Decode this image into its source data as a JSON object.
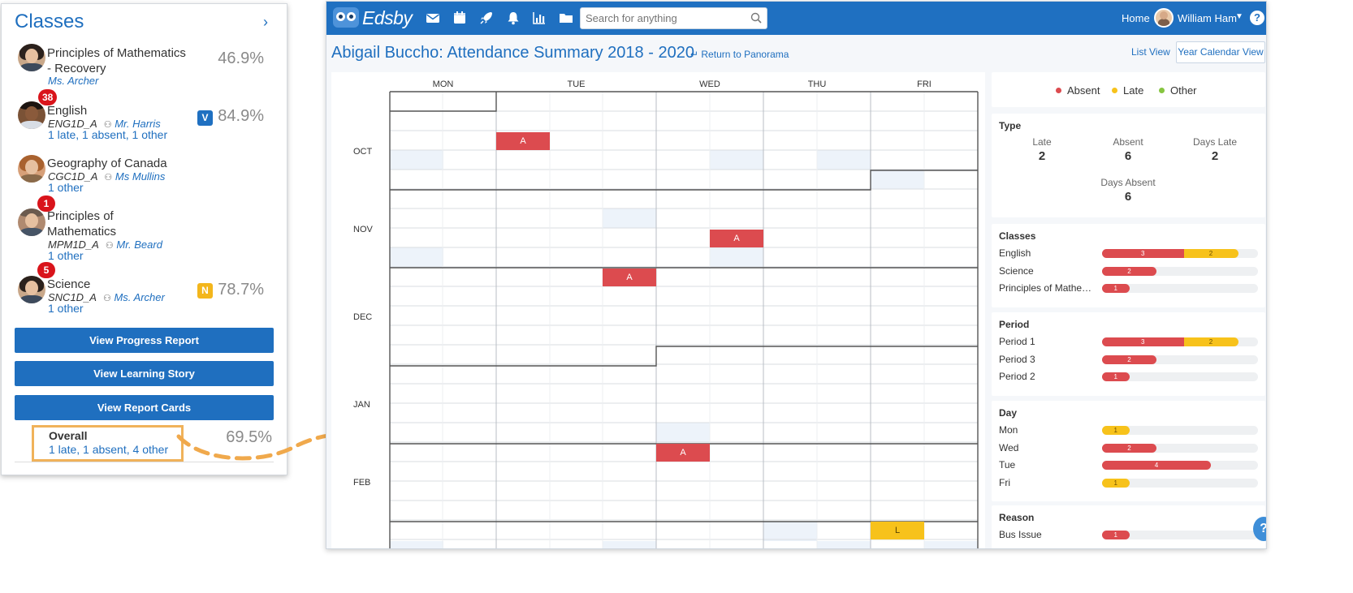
{
  "classes_card": {
    "title": "Classes",
    "chevron": "›",
    "classes": [
      {
        "name": "Principles of Mathematics - Recovery",
        "teacher": "Ms. Archer",
        "percent": "46.9%"
      },
      {
        "name": "English",
        "badge_count": "38",
        "code": "ENG1D_A",
        "teacher": "Mr. Harris",
        "summary": "1 late, 1 absent, 1 other",
        "grade_letter": "V",
        "percent": "84.9%",
        "grade_color": "#1f70c1"
      },
      {
        "name": "Geography of Canada",
        "code": "CGC1D_A",
        "teacher": "Ms Mullins",
        "summary": "1 other"
      },
      {
        "name": "Principles of Mathematics",
        "badge_count": "1",
        "code": "MPM1D_A",
        "teacher": "Mr. Beard",
        "summary": "1 other"
      },
      {
        "name": "Science",
        "badge_count": "5",
        "code": "SNC1D_A",
        "teacher": "Ms. Archer",
        "summary": "1 other",
        "grade_letter": "N",
        "percent": "78.7%",
        "grade_color": "#f3b61c"
      }
    ],
    "buttons": {
      "progress": "View Progress Report",
      "learning": "View Learning Story",
      "report_cards": "View Report Cards"
    },
    "overall": {
      "label": "Overall",
      "summary": "1 late, 1 absent, 4 other",
      "percent": "69.5%"
    }
  },
  "topbar": {
    "logo": "Edsby",
    "nav_icons": [
      "mail-icon",
      "calendar-icon",
      "rocket-icon",
      "bell-icon",
      "bar-chart-icon",
      "folder-icon"
    ],
    "search_placeholder": "Search for anything",
    "home": "Home",
    "user_name": "William Ham",
    "help": "?"
  },
  "page": {
    "title": "Abigail Buccho: Attendance Summary 2018 - 2020",
    "return_link": "↵ Return to Panorama",
    "list_view": "List View",
    "year_view": "Year Calendar View"
  },
  "calendar": {
    "days": [
      "MON",
      "TUE",
      "WED",
      "THU",
      "FRI"
    ],
    "months": [
      "OCT",
      "NOV",
      "DEC",
      "JAN",
      "FEB"
    ],
    "marks": [
      {
        "label": "A",
        "color": "#dc4b4f"
      },
      {
        "label": "A",
        "color": "#dc4b4f"
      },
      {
        "label": "A",
        "color": "#dc4b4f"
      },
      {
        "label": "A",
        "color": "#dc4b4f"
      },
      {
        "label": "L",
        "color": "#f7c21b"
      }
    ]
  },
  "legend": [
    {
      "label": "Absent",
      "color": "#dc4b4f"
    },
    {
      "label": "Late",
      "color": "#f7c21b"
    },
    {
      "label": "Other",
      "color": "#86c540"
    }
  ],
  "type_card": {
    "title": "Type",
    "late_label": "Late",
    "late": "2",
    "absent_label": "Absent",
    "absent": "6",
    "days_late_label": "Days Late",
    "days_late": "2",
    "days_absent_label": "Days Absent",
    "days_absent": "6"
  },
  "breakdowns": [
    {
      "title": "Classes",
      "rows": [
        {
          "label": "English",
          "absent": 3,
          "late": 2
        },
        {
          "label": "Science",
          "absent": 2,
          "late": 0
        },
        {
          "label": "Principles of Mathem...",
          "absent": 1,
          "late": 0
        }
      ]
    },
    {
      "title": "Period",
      "rows": [
        {
          "label": "Period 1",
          "absent": 3,
          "late": 2
        },
        {
          "label": "Period 3",
          "absent": 2,
          "late": 0
        },
        {
          "label": "Period 2",
          "absent": 1,
          "late": 0
        }
      ]
    },
    {
      "title": "Day",
      "rows": [
        {
          "label": "Mon",
          "absent": 0,
          "late": 1
        },
        {
          "label": "Wed",
          "absent": 2,
          "late": 0
        },
        {
          "label": "Tue",
          "absent": 4,
          "late": 0
        },
        {
          "label": "Fri",
          "absent": 0,
          "late": 1
        }
      ]
    },
    {
      "title": "Reason",
      "rows": [
        {
          "label": "Bus Issue",
          "absent": 1,
          "late": 0
        }
      ]
    }
  ],
  "floating_help": "?"
}
